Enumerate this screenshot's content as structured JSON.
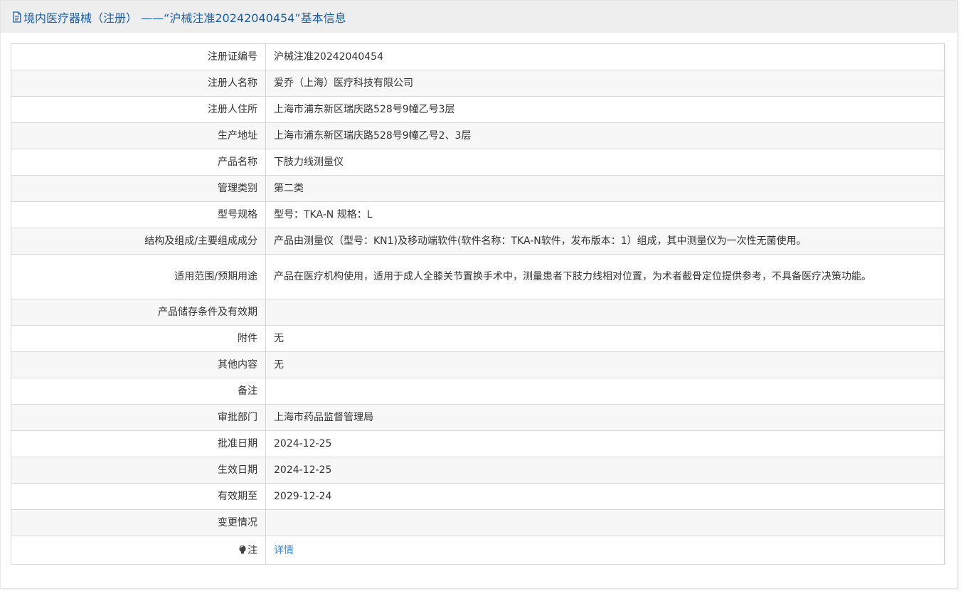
{
  "header": {
    "icon": "document-icon",
    "title": "境内医疗器械（注册） ——“沪械注准20242040454”基本信息"
  },
  "colors": {
    "title_blue": "#1a5fa8",
    "link_blue": "#3b86d6",
    "header_bg": "#eeeeee",
    "row_alt_bg": "#f7f7f7",
    "border": "#d8d8d8"
  },
  "rows": [
    {
      "label": "注册证编号",
      "value": "沪械注准20242040454"
    },
    {
      "label": "注册人名称",
      "value": "爱乔（上海）医疗科技有限公司"
    },
    {
      "label": "注册人住所",
      "value": "上海市浦东新区瑞庆路528号9幢乙号3层"
    },
    {
      "label": "生产地址",
      "value": "上海市浦东新区瑞庆路528号9幢乙号2、3层"
    },
    {
      "label": "产品名称",
      "value": "下肢力线测量仪"
    },
    {
      "label": "管理类别",
      "value": "第二类"
    },
    {
      "label": "型号规格",
      "value": "型号：TKA-N 规格：L"
    },
    {
      "label": "结构及组成/主要组成成分",
      "value": "产品由测量仪（型号：KN1)及移动端软件(软件名称：TKA-N软件，发布版本：1）组成，其中测量仪为一次性无菌使用。"
    },
    {
      "label": "适用范围/预期用途",
      "value": "产品在医疗机构使用，适用于成人全膝关节置换手术中，测量患者下肢力线相对位置，为术者截骨定位提供参考，不具备医疗决策功能。"
    },
    {
      "label": "产品储存条件及有效期",
      "value": ""
    },
    {
      "label": "附件",
      "value": "无"
    },
    {
      "label": "其他内容",
      "value": "无"
    },
    {
      "label": "备注",
      "value": ""
    },
    {
      "label": "审批部门",
      "value": "上海市药品监督管理局"
    },
    {
      "label": "批准日期",
      "value": "2024-12-25"
    },
    {
      "label": "生效日期",
      "value": "2024-12-25"
    },
    {
      "label": "有效期至",
      "value": "2029-12-24"
    },
    {
      "label": "变更情况",
      "value": ""
    }
  ],
  "note_row": {
    "icon": "lightbulb-icon",
    "label": "注",
    "link_text": "详情"
  }
}
